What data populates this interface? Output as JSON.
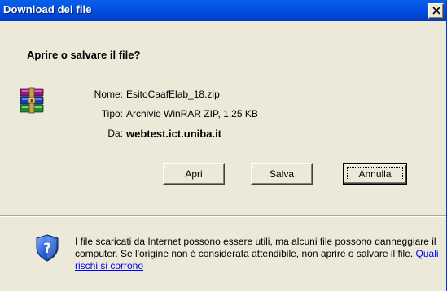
{
  "window": {
    "title": "Download del file"
  },
  "dialog": {
    "heading": "Aprire o salvare il file?",
    "icon": "winrar-archive-icon",
    "fields": {
      "name_label": "Nome:",
      "name_value": "EsitoCaafElab_18.zip",
      "type_label": "Tipo:",
      "type_value": "Archivio WinRAR ZIP, 1,25 KB",
      "from_label": "Da:",
      "from_value": "webtest.ict.uniba.it"
    },
    "buttons": {
      "open": "Apri",
      "save": "Salva",
      "cancel": "Annulla"
    }
  },
  "warning": {
    "icon": "shield-question-icon",
    "text": "I file scaricati da Internet possono essere utili, ma alcuni file possono danneggiare il computer. Se l'origine non è considerata attendibile, non aprire o salvare il file.",
    "link": "Quali rischi si corrono"
  },
  "colors": {
    "titlebar": "#0054e3",
    "dialog_bg": "#ece9d8",
    "link": "#0000ff"
  }
}
